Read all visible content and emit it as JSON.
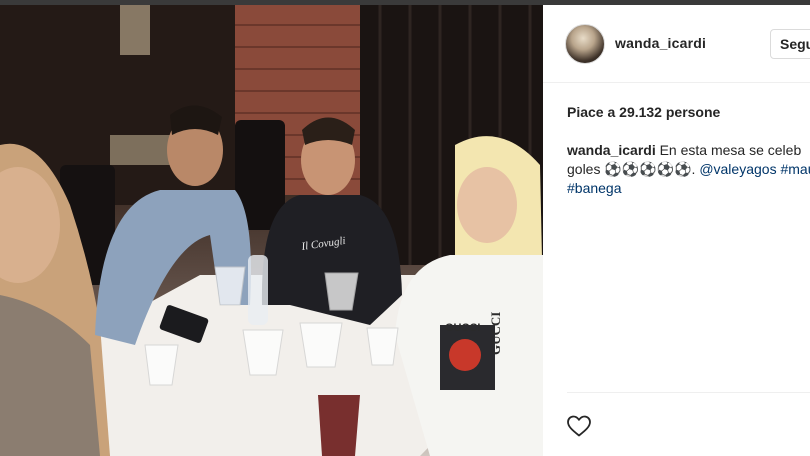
{
  "post": {
    "username": "wanda_icardi",
    "follow_label": "Segui",
    "likes_text": "Piace a 29.132 persone",
    "caption": {
      "user": "wanda_icardi",
      "line1": "En esta mesa se celeb",
      "line2_prefix": "goles ",
      "balls": "⚽⚽⚽⚽⚽",
      "line2_mid": ". ",
      "tag1": "@valeyagos",
      "line2_space": " ",
      "tag2": "#mau",
      "tag3": "#banega"
    }
  },
  "photo": {
    "shirt_text_1": "GUCCI",
    "shirt_text_2": "GUCCI",
    "shirt_script": "Il Covugli"
  },
  "icons": {
    "like": "heart-outline-icon",
    "avatar": "profile-avatar"
  }
}
